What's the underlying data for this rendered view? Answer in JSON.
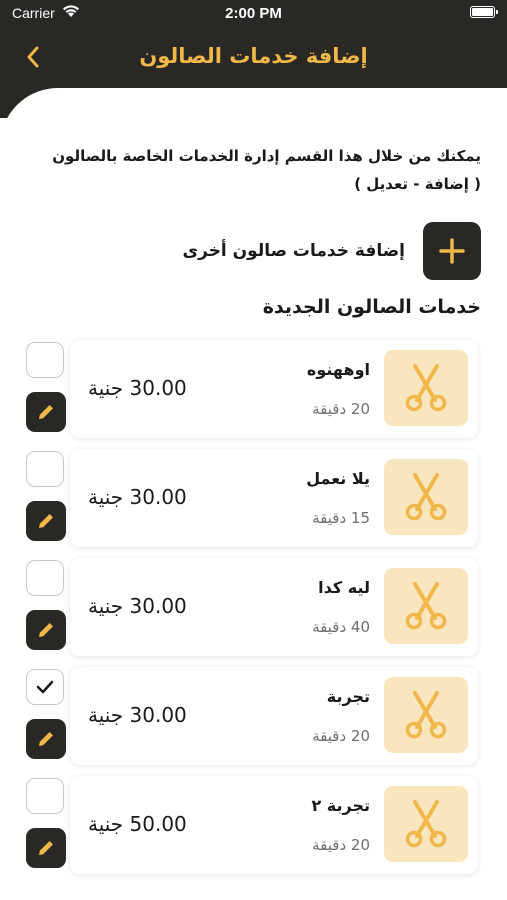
{
  "status_bar": {
    "carrier": "Carrier",
    "time": "2:00 PM"
  },
  "header": {
    "title": "إضافة خدمات الصالون",
    "back_icon": "chevron-left-icon"
  },
  "description": {
    "line1": "يمكنك من خلال هذا القسم إدارة الخدمات الخاصة بالصالون",
    "line2": "( إضافة - تعديل )"
  },
  "add_service": {
    "label": "إضافة خدمات صالون أخرى",
    "icon": "plus-icon"
  },
  "section_title": "خدمات الصالون الجديدة",
  "colors": {
    "dark": "#2a2825",
    "accent": "#f0b84a",
    "thumb_bg": "#f9e6bf"
  },
  "services": [
    {
      "name": "اوههنوه",
      "duration": "20 دقيقة",
      "price": "30.00 جنية",
      "checked": false
    },
    {
      "name": "يلا نعمل",
      "duration": "15 دقيقة",
      "price": "30.00 جنية",
      "checked": false
    },
    {
      "name": "ليه كدا",
      "duration": "40 دقيقة",
      "price": "30.00 جنية",
      "checked": false
    },
    {
      "name": "تجربة",
      "duration": "20 دقيقة",
      "price": "30.00 جنية",
      "checked": true
    },
    {
      "name": "تجربة ٢",
      "duration": "20 دقيقة",
      "price": "50.00 جنية",
      "checked": false
    }
  ]
}
